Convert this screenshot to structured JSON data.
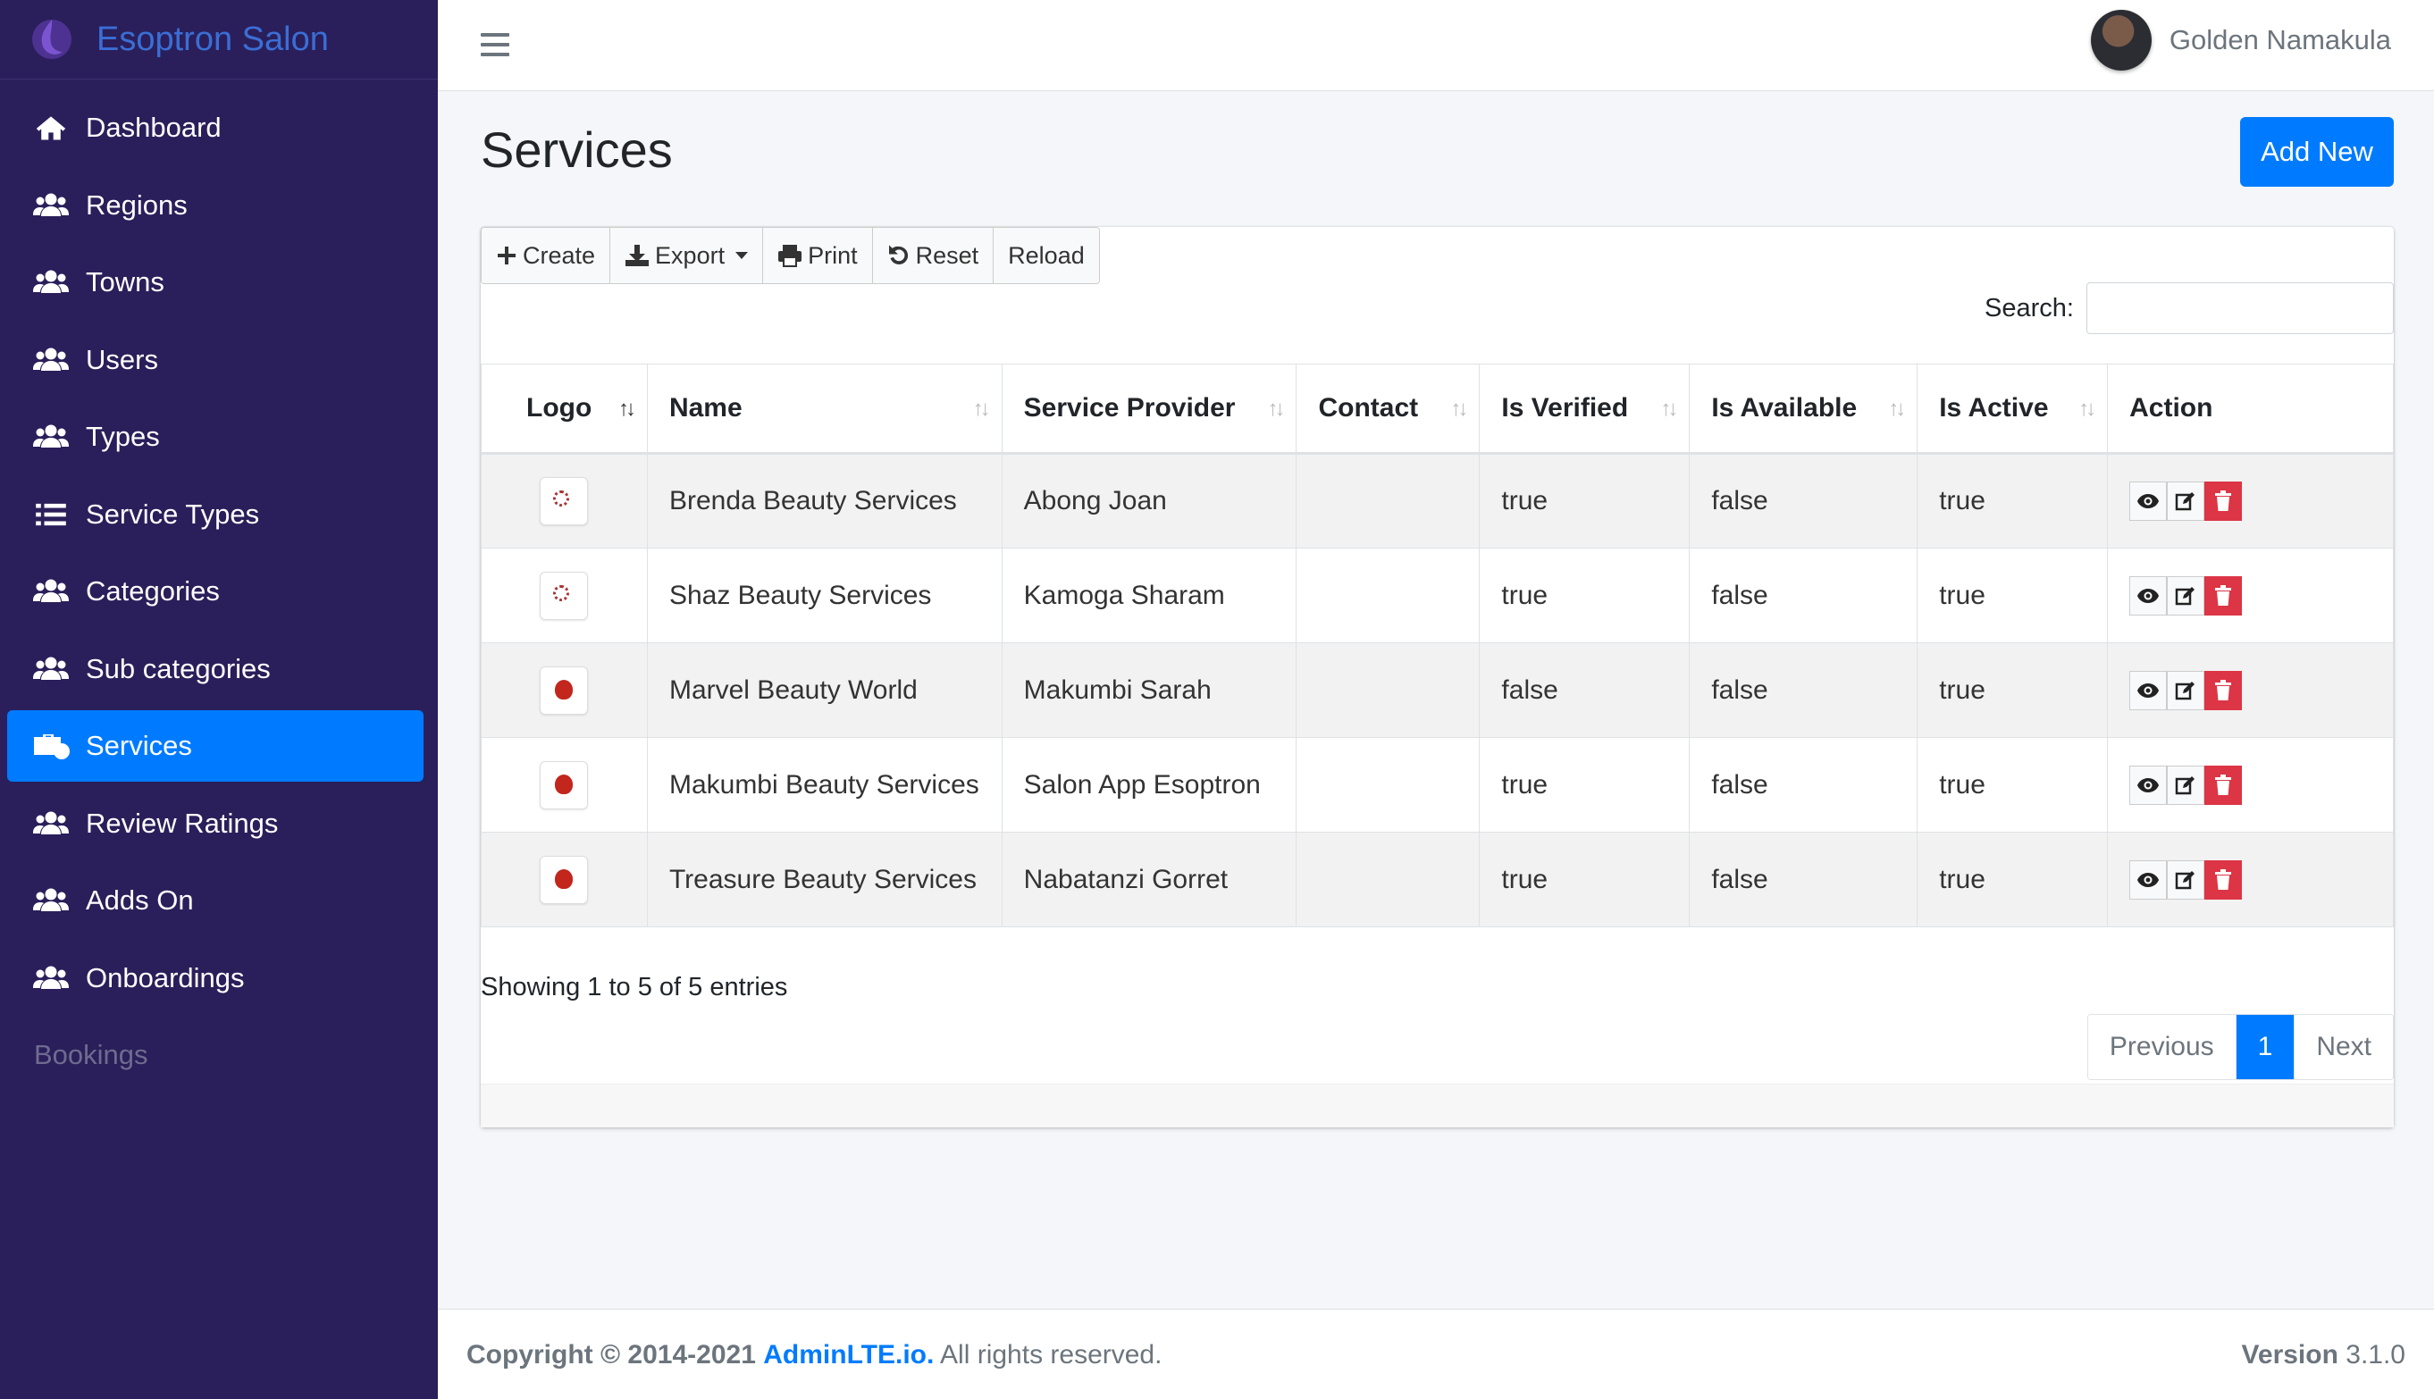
{
  "app": {
    "brand": "Esoptron Salon"
  },
  "sidebar": {
    "items": [
      {
        "label": "Dashboard",
        "icon": "home-icon"
      },
      {
        "label": "Regions",
        "icon": "users-icon"
      },
      {
        "label": "Towns",
        "icon": "users-icon"
      },
      {
        "label": "Users",
        "icon": "users-icon"
      },
      {
        "label": "Types",
        "icon": "users-icon"
      },
      {
        "label": "Service Types",
        "icon": "list-icon"
      },
      {
        "label": "Categories",
        "icon": "users-icon"
      },
      {
        "label": "Sub categories",
        "icon": "users-icon"
      },
      {
        "label": "Services",
        "icon": "briefcase-clock-icon",
        "active": true
      },
      {
        "label": "Review Ratings",
        "icon": "users-icon"
      },
      {
        "label": "Adds On",
        "icon": "users-icon"
      },
      {
        "label": "Onboardings",
        "icon": "users-icon"
      }
    ],
    "section_header": "Bookings",
    "active_color": "#007bff",
    "background": "#2a1f5a"
  },
  "header": {
    "user_name": "Golden Namakula"
  },
  "page": {
    "title": "Services",
    "add_new_label": "Add New"
  },
  "toolbar": {
    "create": "Create",
    "export": "Export",
    "print": "Print",
    "reset": "Reset",
    "reload": "Reload"
  },
  "search": {
    "label": "Search:",
    "value": ""
  },
  "table": {
    "columns": [
      "Logo",
      "Name",
      "Service Provider",
      "Contact",
      "Is Verified",
      "Is Available",
      "Is Active",
      "Action"
    ],
    "rows": [
      {
        "logo": "ring-logo",
        "name": "Brenda Beauty Services",
        "provider": "Abong Joan",
        "contact": "",
        "verified": "true",
        "available": "false",
        "active": "true"
      },
      {
        "logo": "ring-logo",
        "name": "Shaz Beauty Services",
        "provider": "Kamoga Sharam",
        "contact": "",
        "verified": "true",
        "available": "false",
        "active": "true"
      },
      {
        "logo": "rose-logo",
        "name": "Marvel Beauty World",
        "provider": "Makumbi Sarah",
        "contact": "",
        "verified": "false",
        "available": "false",
        "active": "true"
      },
      {
        "logo": "rose-logo",
        "name": "Makumbi Beauty Services",
        "provider": "Salon App Esoptron",
        "contact": "",
        "verified": "true",
        "available": "false",
        "active": "true"
      },
      {
        "logo": "rose-logo",
        "name": "Treasure Beauty Services",
        "provider": "Nabatanzi Gorret",
        "contact": "",
        "verified": "true",
        "available": "false",
        "active": "true"
      }
    ]
  },
  "pagination": {
    "info": "Showing 1 to 5 of 5 entries",
    "previous": "Previous",
    "current": "1",
    "next": "Next"
  },
  "footer": {
    "copyright": "Copyright © 2014-2021",
    "brand_link": "AdminLTE.io.",
    "rights": "All rights reserved.",
    "version_label": "Version",
    "version": "3.1.0"
  }
}
